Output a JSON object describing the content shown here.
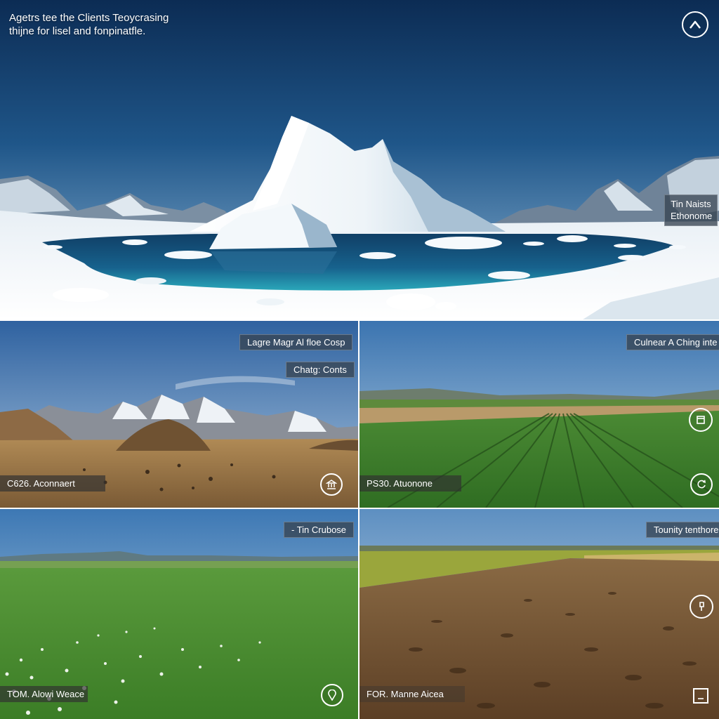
{
  "header": {
    "caption_line1": "Agetrs tee the Clients Teoycrasing",
    "caption_line2": "thijne for lisel and fonpinatfle."
  },
  "icons": {
    "top_right": "chevron-up-icon",
    "mountains_badge": "landmark-icon",
    "crops_top": "box-icon",
    "crops_bottom": "refresh-icon",
    "meadow_badge": "location-pin-icon",
    "soil_top": "pin-icon",
    "soil_bottom": "square-icon"
  },
  "panels": {
    "arctic": {
      "tag_line1": "Tin Naists",
      "tag_line2": "Ethonome"
    },
    "mountains": {
      "tag_top": "Lagre Magr Al floe Cosp",
      "tag_second": "Chatg: Conts",
      "label": "C626. Aconnaert"
    },
    "crops": {
      "tag_top": "Culnear A Ching inte",
      "label": "PS30. Atuonone"
    },
    "meadow": {
      "tag_top": "- Tin Crubose",
      "label": "TOM.  Alowi Weace"
    },
    "soil": {
      "tag_top": "Tounity tenthore",
      "label": "FOR.  Manne Aicea"
    }
  },
  "colors": {
    "sky_top": "#0d2f57",
    "sky_horizon": "#6f9fca",
    "ice": "#f4f8fb",
    "water": "#17557f",
    "grass": "#3f8a2c",
    "soil": "#6b4a2c",
    "tag_bg": "#374452"
  }
}
